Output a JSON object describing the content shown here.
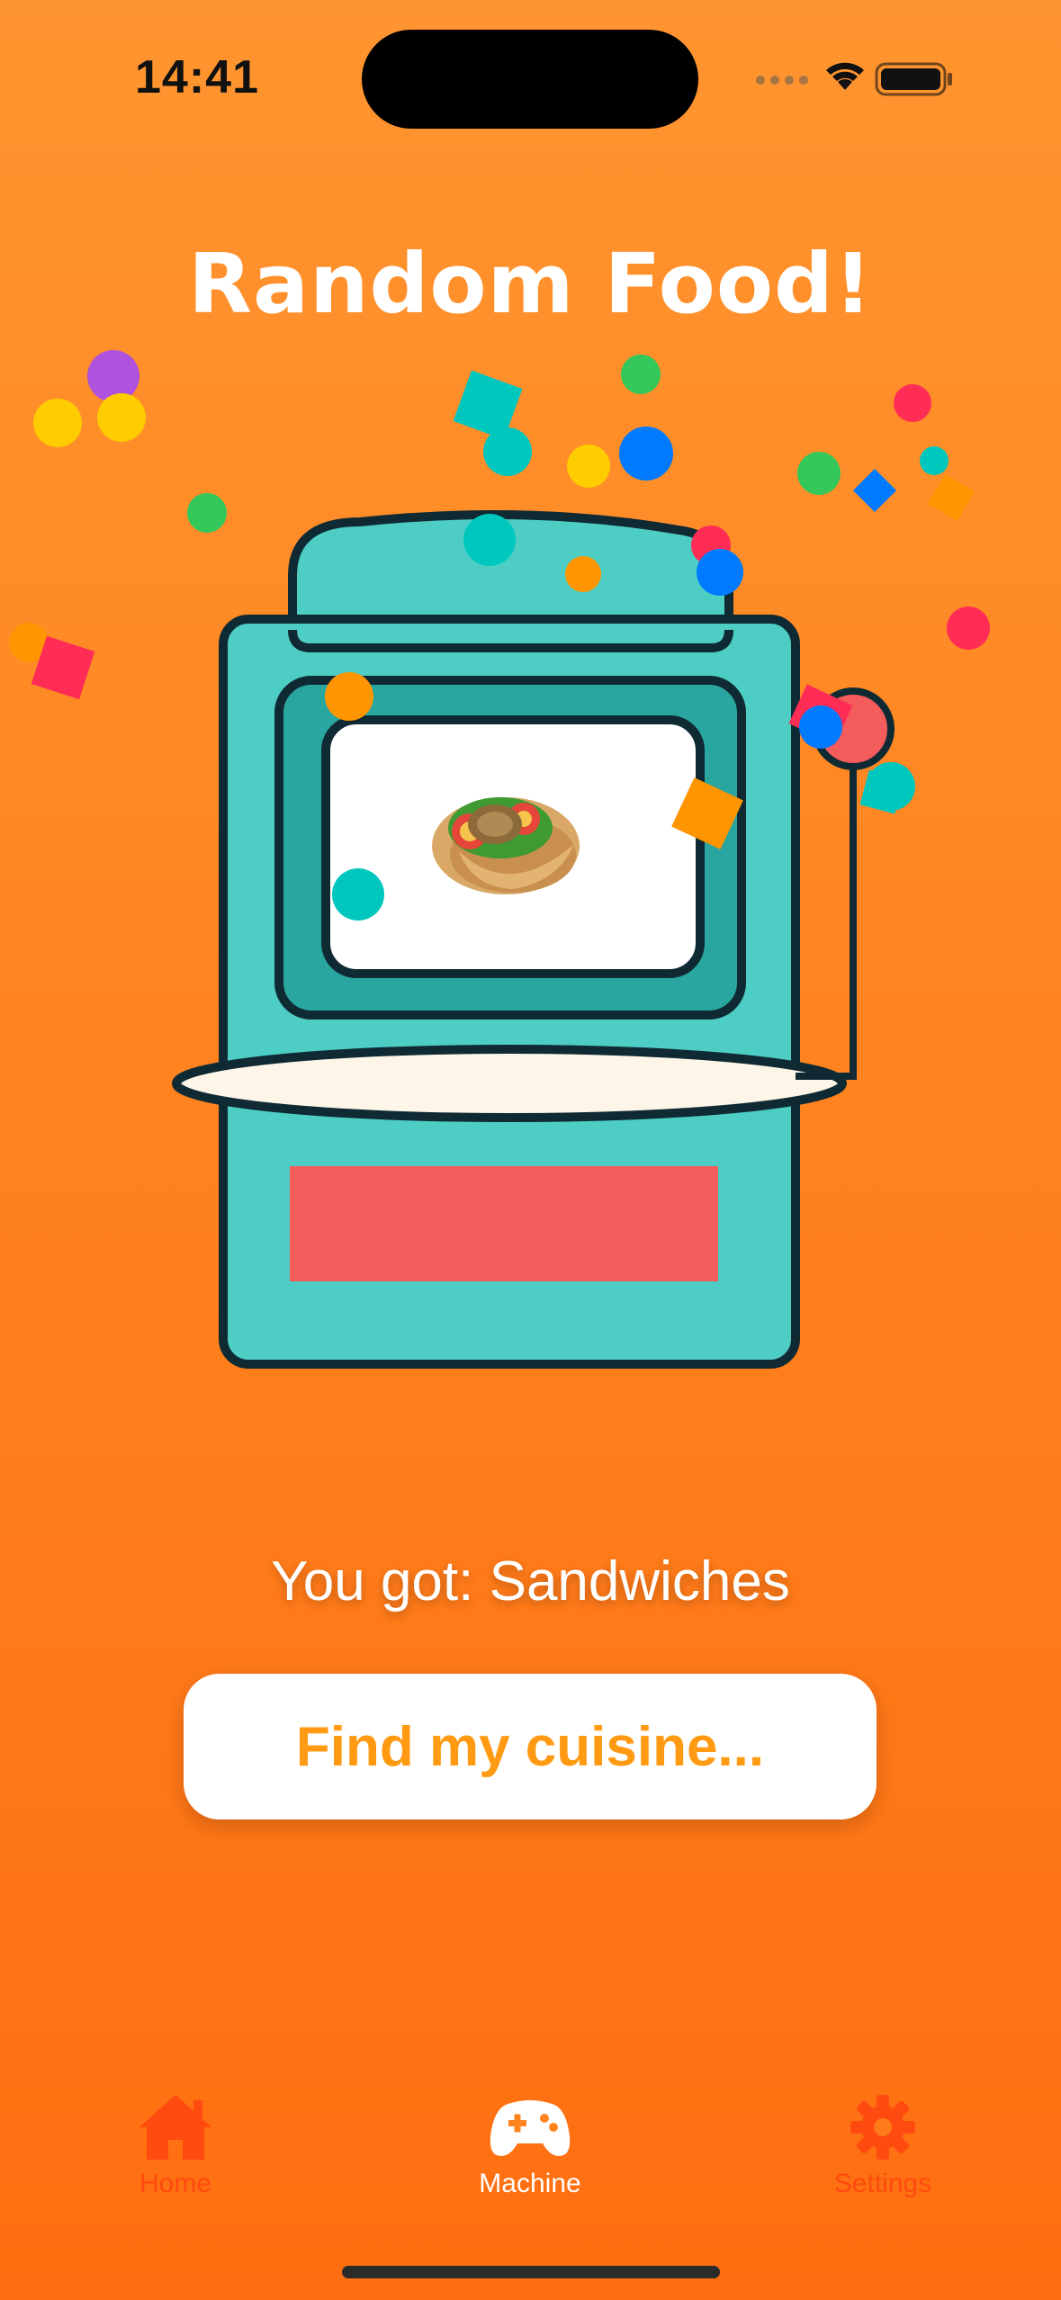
{
  "status_bar": {
    "time": "14:41",
    "icons": [
      "signal-dots-icon",
      "wifi-icon",
      "battery-icon"
    ]
  },
  "app": {
    "title": "Random Food!"
  },
  "machine": {
    "food_icon": "pita-sandwich-icon",
    "colors": {
      "body": "#4ecdc4",
      "screen_frame": "#2aa6a0",
      "outline": "#0f2a33",
      "tray": "#fdf6e8",
      "slot": "#f45b5b",
      "lever_knob": "#f45b5b"
    }
  },
  "result": {
    "text": "You got: Sandwiches"
  },
  "cta": {
    "label": "Find my cuisine..."
  },
  "tabbar": {
    "tabs": [
      {
        "label": "Home",
        "icon": "house-icon",
        "active": false
      },
      {
        "label": "Machine",
        "icon": "gamecontroller-icon",
        "active": true
      },
      {
        "label": "Settings",
        "icon": "gear-icon",
        "active": false
      }
    ]
  },
  "colors": {
    "background_top": "#ff9530",
    "background_bottom": "#ff6e10",
    "accent": "#ff9a12",
    "tab_inactive": "#ff4a10",
    "confetti": [
      "#ffcc00",
      "#af52de",
      "#34c759",
      "#00c7be",
      "#007aff",
      "#ff2d55",
      "#ff9500"
    ]
  }
}
